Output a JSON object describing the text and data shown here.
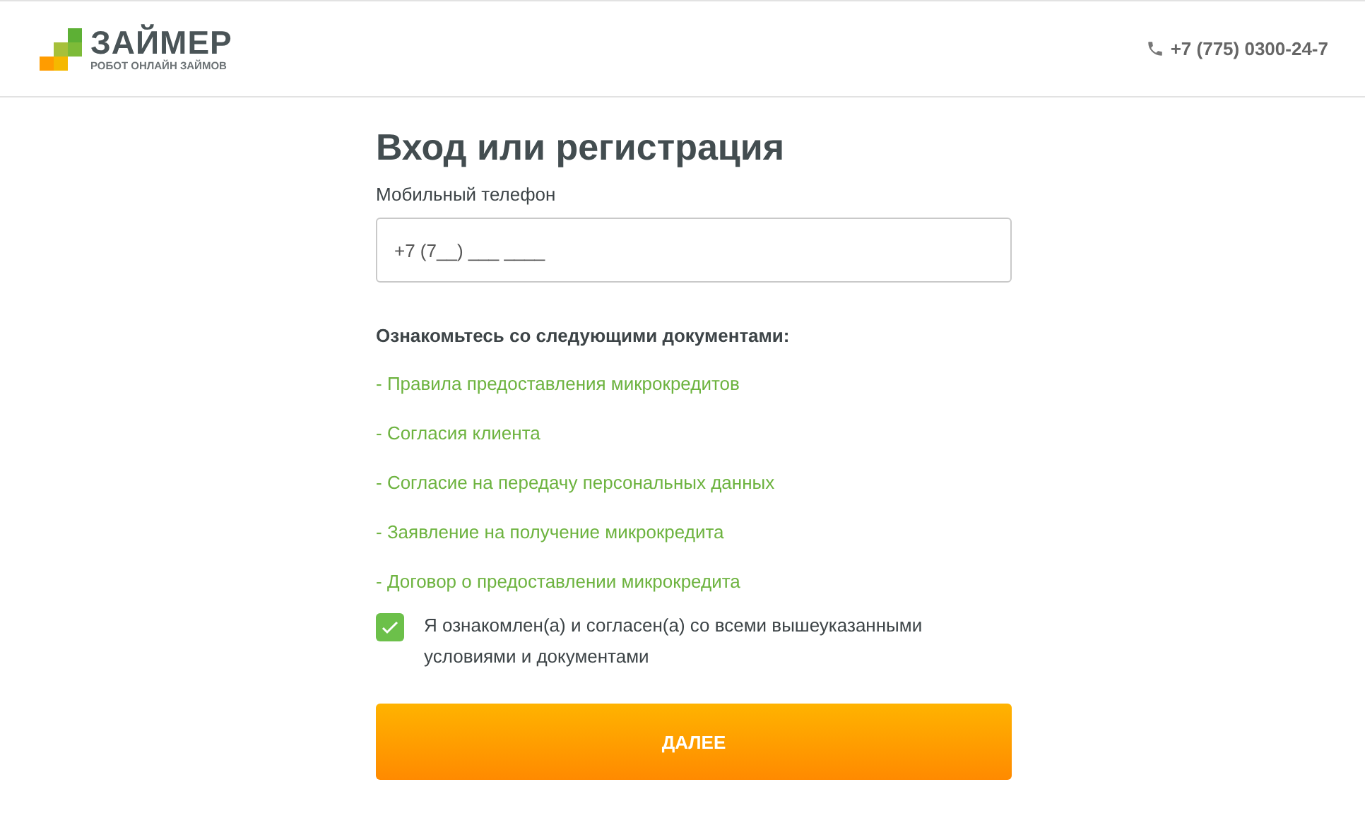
{
  "header": {
    "logo_title": "ЗАЙМЕР",
    "logo_subtitle": "РОБОТ ОНЛАЙН ЗАЙМОВ",
    "phone": "+7 (775) 0300-24-7"
  },
  "form": {
    "title": "Вход или регистрация",
    "phone_label": "Мобильный телефон",
    "phone_field": {
      "placeholder": "+7 (7__) ___ ____"
    },
    "documents_heading": "Ознакомьтесь со следующими документами:",
    "documents": [
      "- Правила предоставления микрокредитов",
      "- Согласия клиента",
      "- Согласие на передачу персональных данных",
      "- Заявление на получение микрокредита",
      "- Договор о предоставлении микрокредита"
    ],
    "agreement": {
      "label": "Я ознакомлен(а) и согласен(а) со всеми вышеуказанными условиями и документами",
      "checked": true
    },
    "submit_button": "ДАЛЕЕ"
  }
}
